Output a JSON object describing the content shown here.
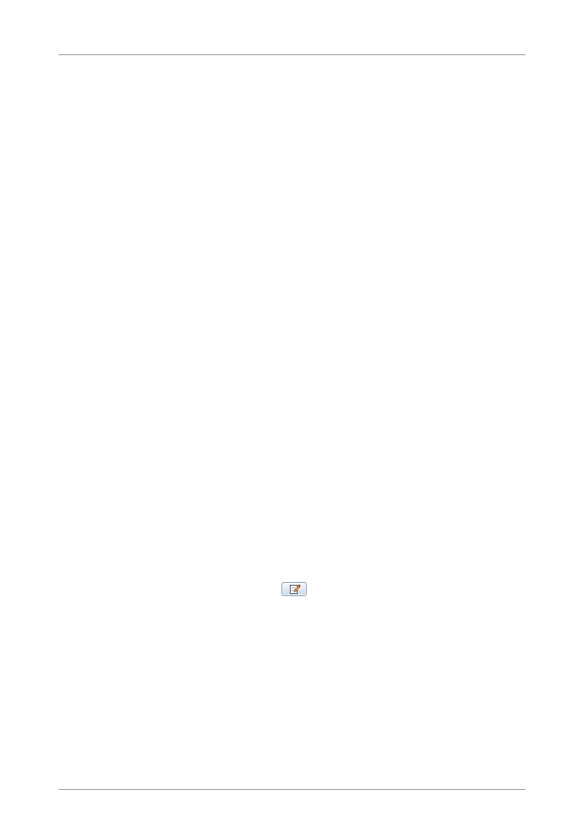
{
  "page": {
    "background_color": "#ffffff",
    "rule_color": "#8a8a8a"
  },
  "edit_button": {
    "icon": "pencil-notepad-icon",
    "accent_color": "#6f8fb8"
  }
}
